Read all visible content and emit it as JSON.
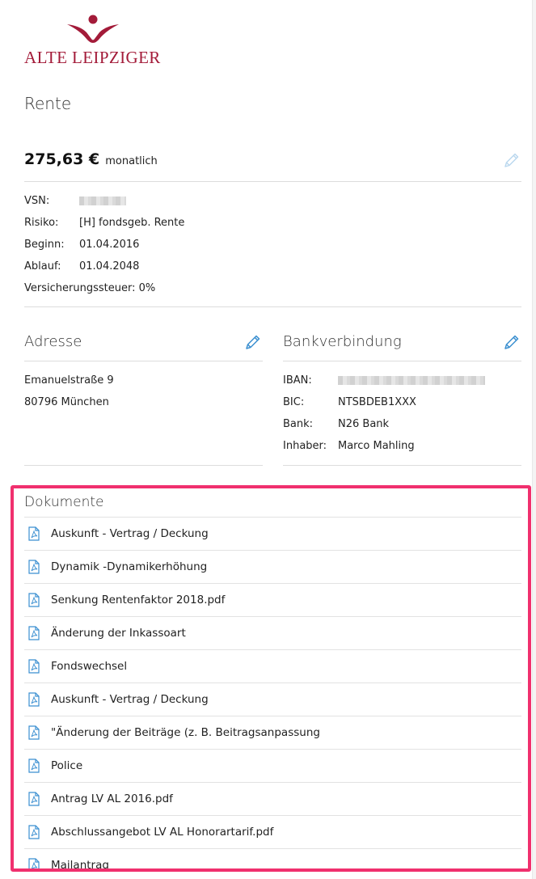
{
  "brand": {
    "name": "ALTE LEIPZIGER",
    "color": "#a31b39"
  },
  "page_title": "Rente",
  "price": {
    "amount": "275,63 €",
    "unit": "monatlich"
  },
  "details": [
    {
      "label": "VSN:",
      "value": "",
      "redacted": true
    },
    {
      "label": "Risiko:",
      "value": "[H] fondsgeb. Rente"
    },
    {
      "label": "Beginn:",
      "value": "01.04.2016"
    },
    {
      "label": "Ablauf:",
      "value": "01.04.2048"
    }
  ],
  "tax_line": "Versicherungssteuer: 0%",
  "address": {
    "title": "Adresse",
    "street": "Emanuelstraße 9",
    "city": "80796 München"
  },
  "bank": {
    "title": "Bankverbindung",
    "rows": [
      {
        "label": "IBAN:",
        "value": "",
        "redacted": true
      },
      {
        "label": "BIC:",
        "value": "NTSBDEB1XXX"
      },
      {
        "label": "Bank:",
        "value": "N26 Bank"
      },
      {
        "label": "Inhaber:",
        "value": "Marco Mahling"
      }
    ]
  },
  "documents": {
    "title": "Dokumente",
    "items": [
      "Auskunft - Vertrag / Deckung",
      "Dynamik -Dynamikerhöhung",
      "Senkung Rentenfaktor 2018.pdf",
      "Änderung der Inkassoart",
      "Fondswechsel",
      "Auskunft - Vertrag / Deckung",
      "\"Änderung der Beiträge (z. B. Beitragsanpassung",
      "Police",
      "Antrag LV AL 2016.pdf",
      "Abschlussangebot LV AL Honorartarif.pdf",
      "Mailantrag"
    ]
  },
  "colors": {
    "highlight": "#f0306e",
    "edit_icon": "#3a8fd0",
    "edit_icon_disabled": "#b9d7ee",
    "pdf_icon": "#3b8fd1"
  }
}
